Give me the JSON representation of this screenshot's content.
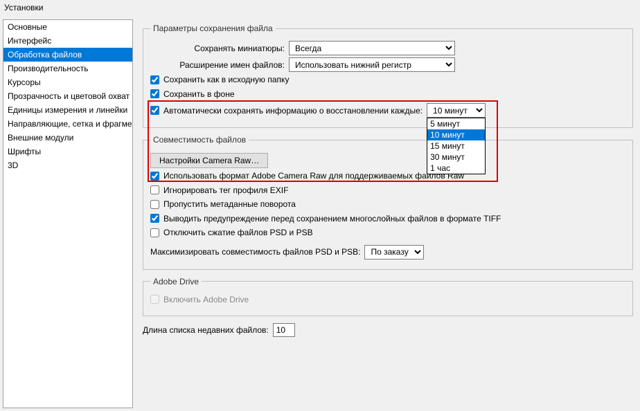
{
  "window_title": "Установки",
  "sidebar": {
    "items": [
      "Основные",
      "Интерфейс",
      "Обработка файлов",
      "Производительность",
      "Курсоры",
      "Прозрачность и цветовой охват",
      "Единицы измерения и линейки",
      "Направляющие, сетка и фрагменты",
      "Внешние модули",
      "Шрифты",
      "3D"
    ],
    "selected_index": 2
  },
  "file_save": {
    "legend": "Параметры сохранения файла",
    "thumb_label": "Сохранять миниатюры:",
    "thumb_value": "Всегда",
    "ext_label": "Расширение имен файлов:",
    "ext_value": "Использовать нижний регистр",
    "save_as_source": "Сохранить как в исходную папку",
    "save_bg": "Сохранить в фоне",
    "autosave_label": "Автоматически сохранять информацию о восстановлении каждые:",
    "autosave_value": "10 минут",
    "autosave_options": [
      "5 минут",
      "10 минут",
      "15 минут",
      "30 минут",
      "1 час"
    ]
  },
  "compat": {
    "legend": "Совместимость файлов",
    "camera_raw_btn": "Настройки Camera Raw…",
    "use_acr": "Использовать формат Adobe Camera Raw для поддерживаемых файлов Raw",
    "ignore_exif": "Игнорировать тег профиля EXIF",
    "skip_rotate": "Пропустить метаданные поворота",
    "tiff_warn": "Выводить предупреждение перед сохранением многослойных файлов в формате TIFF",
    "disable_psd_compress": "Отключить сжатие файлов PSD и PSB",
    "maximize_label": "Максимизировать совместимость файлов PSD и PSB:",
    "maximize_value": "По заказу"
  },
  "adobe_drive": {
    "legend": "Adobe Drive",
    "enable": "Включить Adobe Drive"
  },
  "recent": {
    "label": "Длина списка недавних файлов:",
    "value": "10"
  }
}
